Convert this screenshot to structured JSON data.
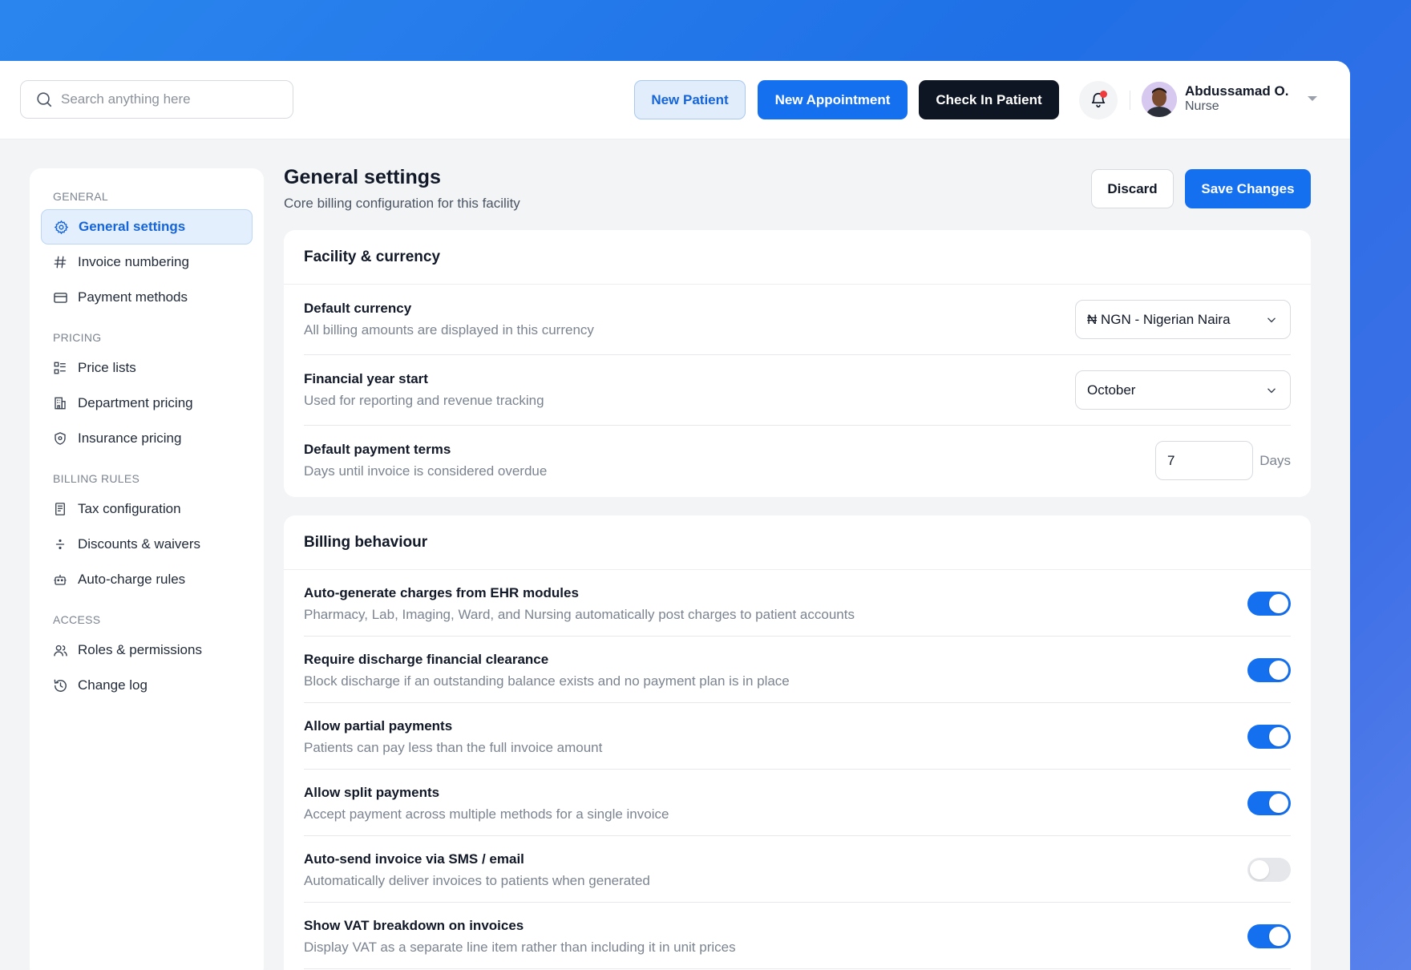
{
  "header": {
    "search_placeholder": "Search anything here",
    "new_patient_label": "New Patient",
    "new_appointment_label": "New Appointment",
    "check_in_label": "Check In Patient",
    "user_name": "Abdussamad O.",
    "user_role": "Nurse"
  },
  "sidebar": {
    "sections": [
      {
        "title": "GENERAL",
        "items": [
          {
            "label": "General settings",
            "icon": "gear-icon",
            "active": true
          },
          {
            "label": "Invoice numbering",
            "icon": "hash-icon"
          },
          {
            "label": "Payment methods",
            "icon": "credit-card-icon"
          }
        ]
      },
      {
        "title": "PRICING",
        "items": [
          {
            "label": "Price lists",
            "icon": "list-icon"
          },
          {
            "label": "Department pricing",
            "icon": "building-icon"
          },
          {
            "label": "Insurance pricing",
            "icon": "shield-icon"
          }
        ]
      },
      {
        "title": "BILLING RULES",
        "items": [
          {
            "label": "Tax configuration",
            "icon": "receipt-icon"
          },
          {
            "label": "Discounts & waivers",
            "icon": "divide-icon"
          },
          {
            "label": "Auto-charge rules",
            "icon": "robot-icon"
          }
        ]
      },
      {
        "title": "ACCESS",
        "items": [
          {
            "label": "Roles & permissions",
            "icon": "users-icon"
          },
          {
            "label": "Change log",
            "icon": "history-icon"
          }
        ]
      }
    ]
  },
  "main": {
    "title": "General settings",
    "subtitle": "Core billing configuration for this facility",
    "discard_label": "Discard",
    "save_label": "Save Changes",
    "facility": {
      "heading": "Facility & currency",
      "rows": [
        {
          "title": "Default currency",
          "desc": "All billing amounts are displayed in this currency",
          "value": "₦ NGN - Nigerian Naira"
        },
        {
          "title": "Financial year start",
          "desc": "Used for reporting and revenue tracking",
          "value": "October"
        },
        {
          "title": "Default payment terms",
          "desc": "Days until invoice is considered overdue",
          "value": "7",
          "unit": "Days"
        }
      ]
    },
    "billing": {
      "heading": "Billing behaviour",
      "rows": [
        {
          "title": "Auto-generate charges from EHR modules",
          "desc": "Pharmacy, Lab, Imaging, Ward, and Nursing automatically post charges to patient accounts",
          "on": true
        },
        {
          "title": "Require discharge financial clearance",
          "desc": "Block discharge if an outstanding balance exists and no payment plan is in place",
          "on": true
        },
        {
          "title": "Allow partial payments",
          "desc": "Patients can pay less than the full invoice amount",
          "on": true
        },
        {
          "title": "Allow split payments",
          "desc": "Accept payment across multiple methods for a single invoice",
          "on": true
        },
        {
          "title": "Auto-send invoice via SMS / email",
          "desc": "Automatically deliver invoices to patients when generated",
          "on": false
        },
        {
          "title": "Show VAT breakdown on invoices",
          "desc": "Display VAT as a separate line item rather than including it in unit prices",
          "on": true
        }
      ]
    }
  },
  "colors": {
    "accent": "#1570ef",
    "dark_button": "#0f1623",
    "active_nav_bg": "#e3effc",
    "toggle_off": "#e5e7eb"
  }
}
